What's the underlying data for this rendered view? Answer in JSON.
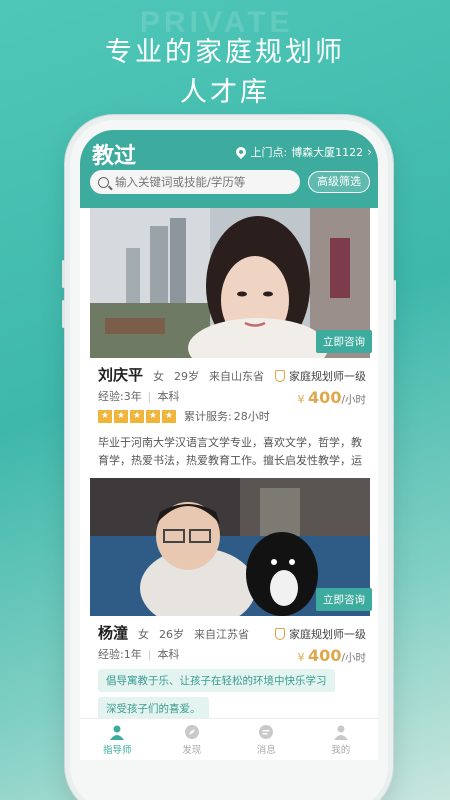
{
  "watermark": "PRIVATE",
  "promo": {
    "line1": "专业的家庭规划师",
    "line2": "人才库"
  },
  "app": {
    "logo": "教过",
    "location_prefix": "上门点:",
    "location": "博森大厦1122",
    "search_placeholder": "输入关键词或技能/学历等",
    "filter_label": "高级筛选",
    "accent": "#3dab9e"
  },
  "planners": [
    {
      "name": "刘庆平",
      "gender": "女",
      "age": "29岁",
      "origin": "来自山东省",
      "certification": "家庭规划师一级",
      "experience": "经验:3年",
      "education": "本科",
      "price_symbol": "¥",
      "price": "400",
      "price_unit": "/小时",
      "service_label": "累计服务:",
      "service_hours": "28小时",
      "rating_stars": 5,
      "description": "毕业于河南大学汉语言文学专业，喜欢文学，哲学，教育学，热爱书法，热爱教育工作。擅长启发性教学，运用形...",
      "consult_label": "立即咨询"
    },
    {
      "name": "杨潼",
      "gender": "女",
      "age": "26岁",
      "origin": "来自江苏省",
      "certification": "家庭规划师一级",
      "experience": "经验:1年",
      "education": "本科",
      "price_symbol": "¥",
      "price": "400",
      "price_unit": "/小时",
      "tags": [
        "倡导寓教于乐、让孩子在轻松的环境中快乐学习",
        "深受孩子们的喜爱。"
      ],
      "consult_label": "立即咨询"
    }
  ],
  "tabs": [
    {
      "label": "指导师",
      "icon": "person-icon",
      "active": true
    },
    {
      "label": "发现",
      "icon": "compass-icon",
      "active": false
    },
    {
      "label": "消息",
      "icon": "chat-icon",
      "active": false
    },
    {
      "label": "我的",
      "icon": "user-icon",
      "active": false
    }
  ]
}
